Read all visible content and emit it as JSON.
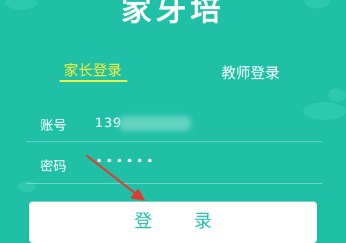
{
  "app": {
    "title": "家牙培"
  },
  "tabs": [
    {
      "label": "家长登录",
      "active": true
    },
    {
      "label": "教师登录",
      "active": false
    }
  ],
  "fields": {
    "account": {
      "label": "账号",
      "value": "139"
    },
    "password": {
      "label": "密码",
      "value": "••••••"
    }
  },
  "login_button": {
    "label": "登 录"
  },
  "colors": {
    "background": "#1fc0a6",
    "active_tab": "#f5ee3d",
    "arrow": "#e23a2f",
    "button_bg": "#ffffff",
    "button_text": "#1fc0a6"
  }
}
